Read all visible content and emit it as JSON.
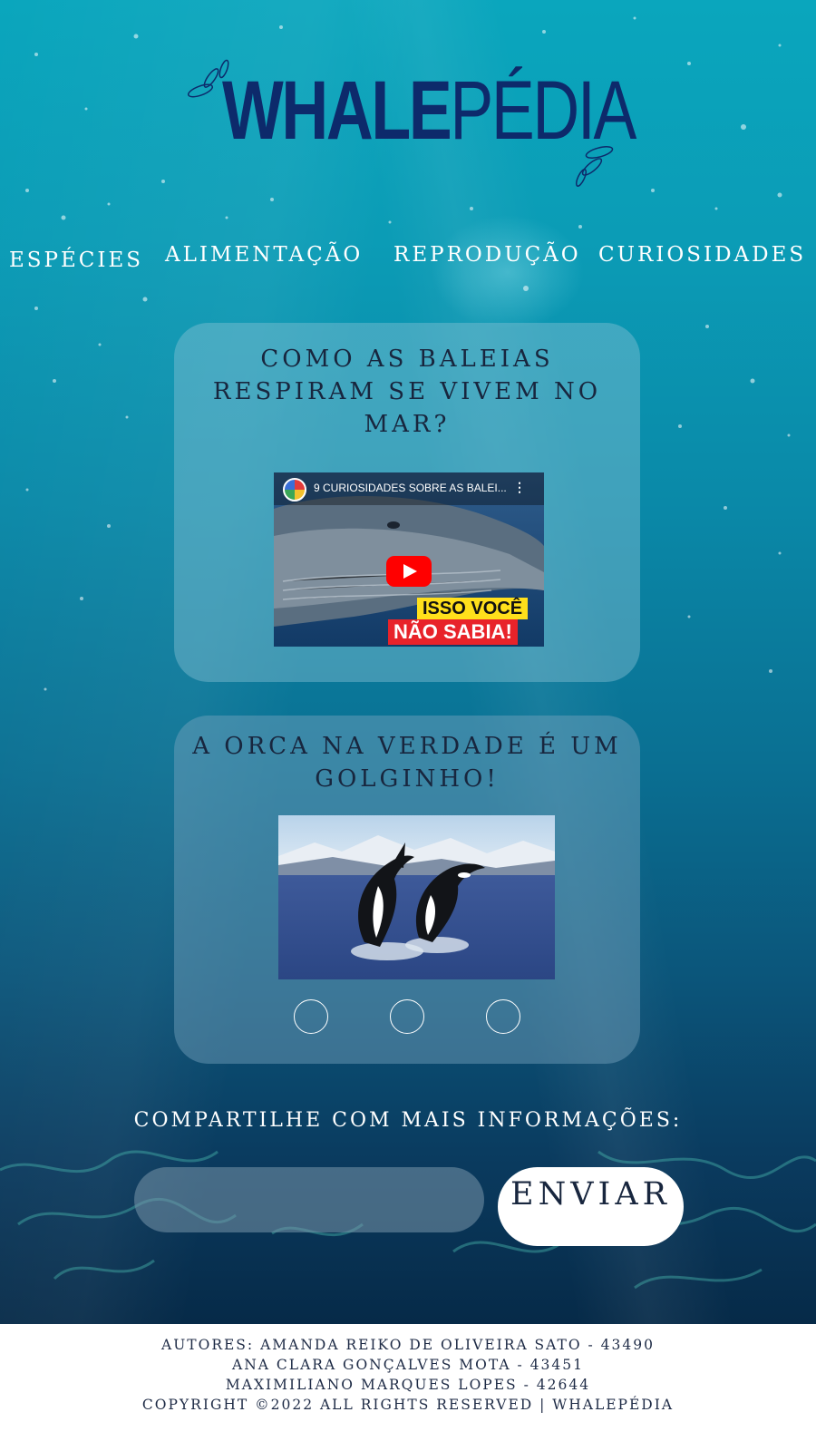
{
  "logo": {
    "bold_part": "WHALE",
    "light_part": "PÉDIA",
    "color": "#0d2a6b"
  },
  "nav": {
    "items": [
      {
        "label": "ESPÉCIES"
      },
      {
        "label": "ALIMENTAÇÃO"
      },
      {
        "label": "REPRODUÇÃO"
      },
      {
        "label": "CURIOSIDADES"
      }
    ]
  },
  "cards": [
    {
      "title": "COMO AS BALEIAS RESPIRAM SE VIVEM NO MAR?",
      "video": {
        "title": "9 CURIOSIDADES SOBRE AS BALEI...",
        "menu_icon": "more-vertical-icon",
        "play_icon": "youtube-play-icon",
        "badge_line1": "ISSO VOCÊ",
        "badge_line2": "NÃO SABIA!"
      }
    },
    {
      "title": "A ORCA NA VERDADE É UM GOLGINHO!",
      "carousel": {
        "dot_count": 3
      }
    }
  ],
  "share": {
    "label": "COMPARTILHE COM MAIS INFORMAÇÕES:",
    "input_value": "",
    "input_placeholder": "",
    "button_label": "ENVIAR"
  },
  "footer": {
    "lines": [
      "AUTORES: AMANDA REIKO DE OLIVEIRA SATO - 43490",
      "ANA CLARA GONÇALVES MOTA - 43451",
      "MAXIMILIANO MARQUES LOPES - 42644",
      "COPYRIGHT ©2022 ALL RIGHTS RESERVED | WHALEPÉDIA"
    ]
  },
  "colors": {
    "ocean_top": "#0aa6bd",
    "ocean_bottom": "#062a48",
    "text_dark": "#18263e",
    "youtube_red": "#ff0000"
  }
}
